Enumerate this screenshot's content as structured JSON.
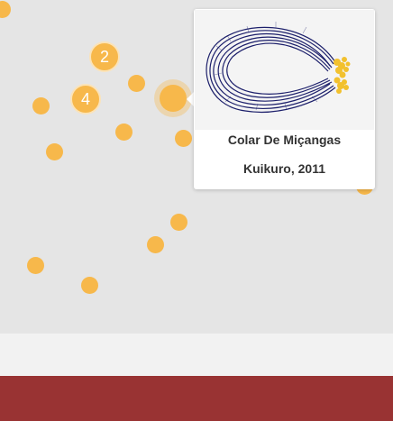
{
  "map": {
    "clusters": [
      {
        "count": "2"
      },
      {
        "count": "4"
      }
    ]
  },
  "popup": {
    "title": "Colar De Miçangas",
    "subtitle": "Kuikuro, 2011",
    "image_icon": "beaded-necklace-image"
  },
  "colors": {
    "map_background": "#e5e5e5",
    "marker": "#f7b84b",
    "footer_light": "#f2f2f2",
    "footer_red": "#993333",
    "necklace": "#1c1f6b"
  }
}
